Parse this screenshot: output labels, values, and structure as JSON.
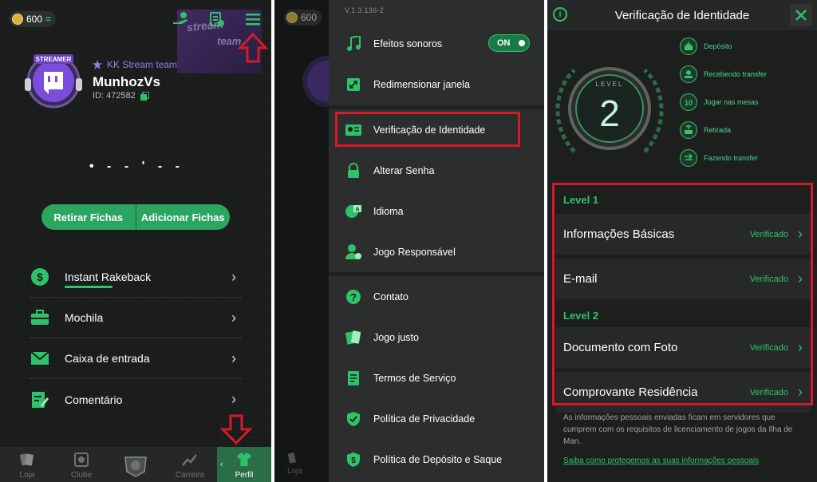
{
  "colors": {
    "accent_green": "#2ec36a",
    "highlight_red": "#d8192a",
    "background": "#1c1e1d"
  },
  "profile": {
    "coins": "600",
    "banner_text_1": "stream",
    "banner_text_2": "team",
    "team": "KK Stream team",
    "username": "MunhozVs",
    "user_id": "ID: 472582",
    "masked_info": "• - - ' - -",
    "withdraw_button": "Retirar Fichas",
    "add_button": "Adicionar Fichas",
    "menu": [
      {
        "label": "Instant Rakeback",
        "icon": "dollar-icon"
      },
      {
        "label": "Mochila",
        "icon": "briefcase-icon"
      },
      {
        "label": "Caixa de entrada",
        "icon": "mail-icon"
      },
      {
        "label": "Comentário",
        "icon": "edit-icon"
      }
    ],
    "tabs": [
      {
        "label": "Loja",
        "icon": "cards-icon"
      },
      {
        "label": "Clube",
        "icon": "club-icon"
      },
      {
        "label": "",
        "icon": "poker-emblem-icon"
      },
      {
        "label": "Carreira",
        "icon": "chart-icon"
      },
      {
        "label": "Perfil",
        "icon": "jersey-icon"
      }
    ]
  },
  "settings": {
    "coins": "600",
    "dim_tab": "Loja",
    "version": "V.1.3.136-2",
    "items": [
      {
        "label": "Efeitos sonoros",
        "icon": "music-icon",
        "toggle": "ON"
      },
      {
        "label": "Redimensionar janela",
        "icon": "resize-icon"
      },
      {
        "label": "Verificação de Identidade",
        "icon": "id-card-icon"
      },
      {
        "label": "Alterar Senha",
        "icon": "lock-icon"
      },
      {
        "label": "Idioma",
        "icon": "language-icon"
      },
      {
        "label": "Jogo Responsável",
        "icon": "user-settings-icon"
      },
      {
        "label": "Contato",
        "icon": "help-icon"
      },
      {
        "label": "Jogo justo",
        "icon": "cards-icon"
      },
      {
        "label": "Termos de Serviço",
        "icon": "document-icon"
      },
      {
        "label": "Política de Privacidade",
        "icon": "shield-icon"
      },
      {
        "label": "Política de Depósito e Saque",
        "icon": "deposit-icon"
      }
    ]
  },
  "verification": {
    "title": "Verificação de Identidade",
    "level_label": "LEVEL",
    "level_number": "2",
    "perks": [
      {
        "label": "Depósito",
        "icon": "deposit-icon"
      },
      {
        "label": "Recebendo transfer",
        "icon": "receive-icon"
      },
      {
        "label": "Jogar nas mesas",
        "icon": "table-icon"
      },
      {
        "label": "Retirada",
        "icon": "withdraw-icon"
      },
      {
        "label": "Fazendo transfer",
        "icon": "transfer-icon"
      }
    ],
    "level1_title": "Level 1",
    "level2_title": "Level 2",
    "rows": [
      {
        "label": "Informações Básicas",
        "status": "Verificado"
      },
      {
        "label": "E-mail",
        "status": "Verificado"
      },
      {
        "label": "Documento com Foto",
        "status": "Verificado"
      },
      {
        "label": "Comprovante Residência",
        "status": "Verificado"
      }
    ],
    "footer_text": "As informações pessoais enviadas ficam em servidores que cumprem com os requisitos de licenciamento de jogos da Ilha de Man.",
    "footer_link": "Saiba como protegemos as suas informações pessoais"
  }
}
